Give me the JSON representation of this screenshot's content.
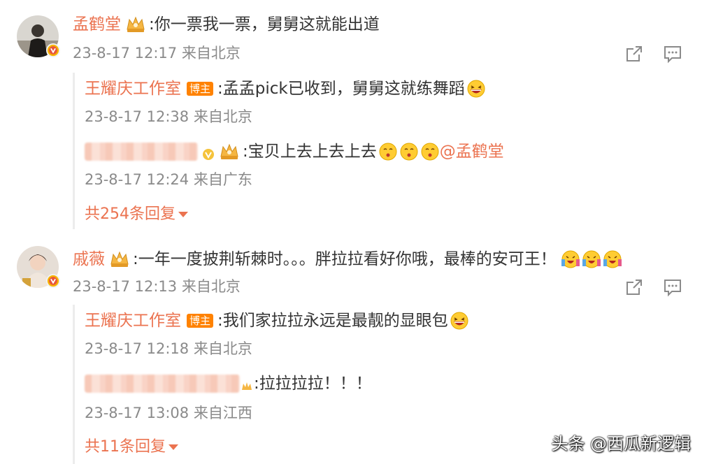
{
  "comments": [
    {
      "author": "孟鹤堂",
      "text": ":你一票我一票，舅舅这就能出道",
      "meta": "23-8-17 12:17 来自北京",
      "replies": [
        {
          "author": "王耀庆工作室",
          "badge": "博主",
          "text": ":孟孟pick已收到，舅舅这就练舞蹈",
          "meta": "23-8-17 12:38 来自北京"
        },
        {
          "author": "",
          "text": ":宝贝上去上去上去",
          "mention": "@孟鹤堂",
          "meta": "23-8-17 12:24 来自广东"
        }
      ],
      "more": "共254条回复"
    },
    {
      "author": "戚薇",
      "text": ":一年一度披荆斩棘时。。。胖拉拉看好你哦，最棒的安可王！",
      "meta": "23-8-17 12:13 来自北京",
      "replies": [
        {
          "author": "王耀庆工作室",
          "badge": "博主",
          "text": ":我们家拉拉永远是最靓的显眼包",
          "meta": "23-8-17 12:18 来自北京"
        },
        {
          "author": "",
          "text": ":拉拉拉拉！！！",
          "meta": "23-8-17 13:08 来自江西"
        }
      ],
      "more": "共11条回复"
    }
  ],
  "watermark": "头条 @西瓜新逻辑",
  "colors": {
    "accent": "#eb7350",
    "meta": "#8a8a8a",
    "badge": "#ff8200"
  }
}
